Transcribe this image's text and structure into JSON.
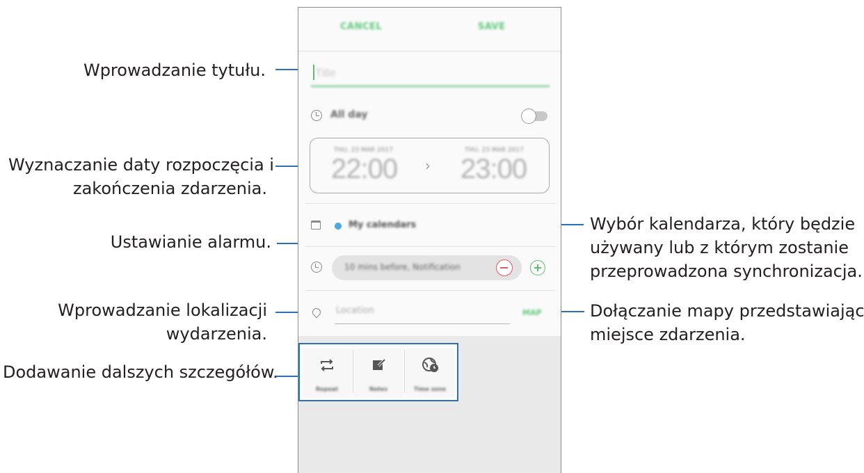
{
  "app": {
    "cancel_label": "CANCEL",
    "save_label": "SAVE",
    "title_placeholder": "Title",
    "all_day_label": "All day",
    "start": {
      "date": "THU, 23 MAR 2017",
      "time": "22:00"
    },
    "end": {
      "date": "THU, 23 MAR 2017",
      "time": "23:00"
    },
    "calendar_label": "My calendars",
    "alarm_label": "10 mins before, Notification",
    "location_placeholder": "Location",
    "map_label": "MAP",
    "details": [
      {
        "label": "Repeat",
        "icon": "repeat-icon"
      },
      {
        "label": "Notes",
        "icon": "notes-icon"
      },
      {
        "label": "Time zone",
        "icon": "time-zone-icon"
      }
    ],
    "accent_color": "#5fc87a",
    "calendar_color": "#4ba9e0",
    "remove_color": "#e4565e"
  },
  "annotations": {
    "title": "Wprowadzanie tytułu.",
    "dates_line1": "Wyznaczanie daty rozpoczęcia i",
    "dates_line2": "zakończenia zdarzenia.",
    "alarm": "Ustawianie alarmu.",
    "location_line1": "Wprowadzanie lokalizacji",
    "location_line2": "wydarzenia.",
    "details": "Dodawanie dalszych szczegółów.",
    "calendar_line1": "Wybór kalendarza, który będzie",
    "calendar_line2": "używany lub z którym zostanie",
    "calendar_line3": "przeprowadzona synchronizacja.",
    "map_line1": "Dołączanie mapy przedstawiającej",
    "map_line2": "miejsce zdarzenia."
  },
  "leader_color": "#2b71b8"
}
